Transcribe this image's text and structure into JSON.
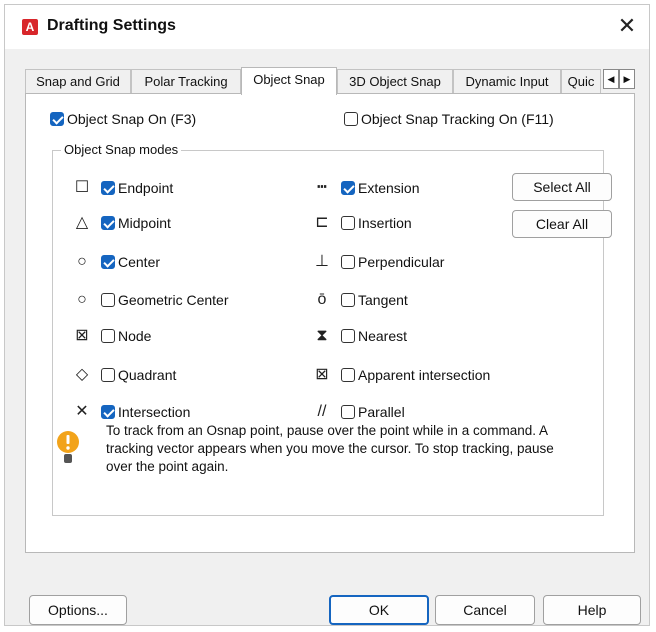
{
  "window": {
    "title": "Drafting Settings",
    "app_icon_letter": "A",
    "close": "✕"
  },
  "tabs": [
    {
      "label": "Snap and Grid"
    },
    {
      "label": "Polar Tracking"
    },
    {
      "label": "Object Snap",
      "active": true
    },
    {
      "label": "3D Object Snap"
    },
    {
      "label": "Dynamic Input"
    },
    {
      "label": "Quic"
    }
  ],
  "tab_scroll": {
    "left": "◀",
    "right": "▶"
  },
  "object_snap_on": {
    "label": "Object Snap On (F3)",
    "checked": true
  },
  "object_snap_tracking_on": {
    "label": "Object Snap Tracking On (F11)",
    "checked": false
  },
  "modes_group": {
    "title": "Object Snap modes"
  },
  "modes_left": [
    {
      "symbol": "☐",
      "icon": "square-icon",
      "label": "Endpoint",
      "checked": true
    },
    {
      "symbol": "△",
      "icon": "triangle-icon",
      "label": "Midpoint",
      "checked": true
    },
    {
      "symbol": "○",
      "icon": "circle-icon",
      "label": "Center",
      "checked": true
    },
    {
      "symbol": "○",
      "icon": "circle-icon",
      "label": "Geometric Center",
      "checked": false
    },
    {
      "symbol": "⊠",
      "icon": "node-icon",
      "label": "Node",
      "checked": false
    },
    {
      "symbol": "◇",
      "icon": "diamond-icon",
      "label": "Quadrant",
      "checked": false
    },
    {
      "symbol": "✕",
      "icon": "x-icon",
      "label": "Intersection",
      "checked": true
    }
  ],
  "modes_right": [
    {
      "symbol": "┅",
      "icon": "dashes-icon",
      "label": "Extension",
      "checked": true
    },
    {
      "symbol": "⊏",
      "icon": "insertion-icon",
      "label": "Insertion",
      "checked": false
    },
    {
      "symbol": "⊥",
      "icon": "perpendicular-icon",
      "label": "Perpendicular",
      "checked": false
    },
    {
      "symbol": "ō",
      "icon": "tangent-icon",
      "label": "Tangent",
      "checked": false
    },
    {
      "symbol": "⧗",
      "icon": "hourglass-icon",
      "label": "Nearest",
      "checked": false
    },
    {
      "symbol": "⊠",
      "icon": "boxed-x-icon",
      "label": "Apparent intersection",
      "checked": false
    },
    {
      "symbol": "//",
      "icon": "parallel-icon",
      "label": "Parallel",
      "checked": false
    }
  ],
  "select_all_label": "Select All",
  "clear_all_label": "Clear All",
  "hint": "To track from an Osnap point, pause over the point while in a command.  A tracking vector appears when you move the cursor.  To stop tracking, pause over the point again.",
  "footer": {
    "options_label": "Options...",
    "ok_label": "OK",
    "cancel_label": "Cancel",
    "help_label": "Help"
  },
  "colors": {
    "accent": "#1565c0",
    "app_icon": "#d8262b",
    "hint_icon": "#f2a31a"
  }
}
